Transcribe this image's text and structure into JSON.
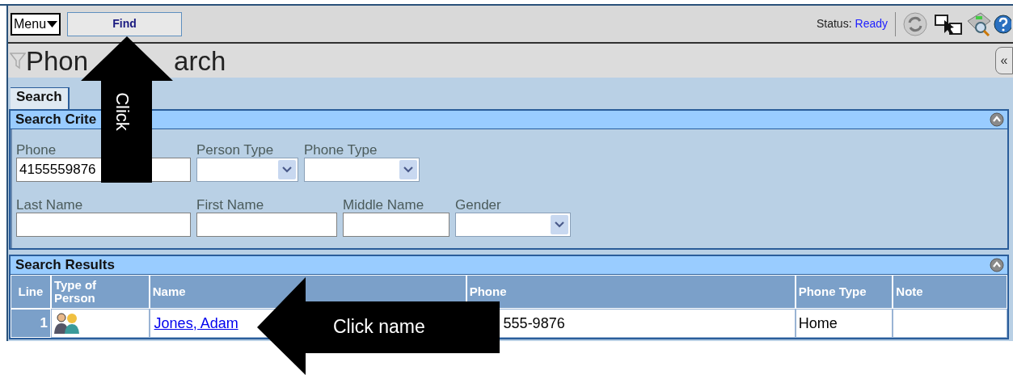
{
  "toolbar": {
    "menu": "Menu",
    "find_button": "Find",
    "status_label": "Status:",
    "status_value": "Ready"
  },
  "page_title": {
    "start": "Phon",
    "end": "arch",
    "collapse": "«"
  },
  "tabs": [
    {
      "label": "Search",
      "selected": true
    }
  ],
  "criteria": {
    "title": "Search Crite",
    "rows": [
      [
        {
          "kind": "text",
          "label": "Phone",
          "value": "4155559876"
        },
        {
          "kind": "select",
          "label": "Person Type"
        },
        {
          "kind": "select",
          "label": "Phone Type"
        }
      ],
      [
        {
          "kind": "text",
          "label": "Last Name"
        },
        {
          "kind": "text",
          "label": "First Name"
        },
        {
          "kind": "text",
          "label": "Middle Name"
        },
        {
          "kind": "select",
          "label": "Gender"
        }
      ]
    ]
  },
  "results": {
    "title": "Search Results",
    "columns": [
      "Line",
      "Type of Person",
      "Name",
      "Phone",
      "Phone Type",
      "Note"
    ],
    "rows": [
      {
        "line": "1",
        "name": "Jones, Adam",
        "phone": "555-9876",
        "phone_type": "Home"
      }
    ]
  },
  "annotations": [
    {
      "kind": "arrow-up",
      "label": "Click"
    },
    {
      "kind": "arrow-left",
      "label": "Click name"
    }
  ]
}
